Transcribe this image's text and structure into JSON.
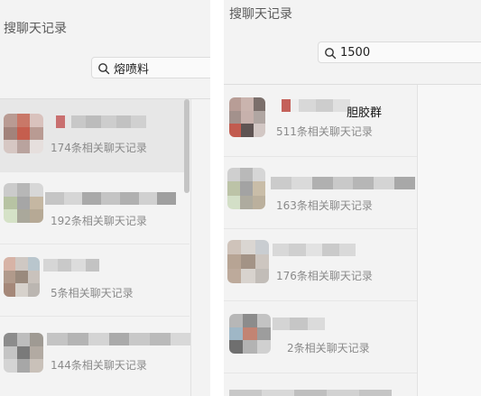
{
  "left": {
    "title": "搜聊天记录",
    "search_value": "熔喷料",
    "results": [
      {
        "count": "174条相关聊天记录"
      },
      {
        "count": "192条相关聊天记录"
      },
      {
        "count": "5条相关聊天记录"
      },
      {
        "count": "144条相关聊天记录"
      }
    ]
  },
  "right": {
    "title": "搜聊天记录",
    "search_value": "1500",
    "results": [
      {
        "name_suffix": "胆胶群",
        "count": "511条相关聊天记录"
      },
      {
        "count": "163条相关聊天记录"
      },
      {
        "count": "176条相关聊天记录"
      },
      {
        "count": "2条相关聊天记录"
      }
    ]
  },
  "icons": {
    "search": "search-icon"
  }
}
